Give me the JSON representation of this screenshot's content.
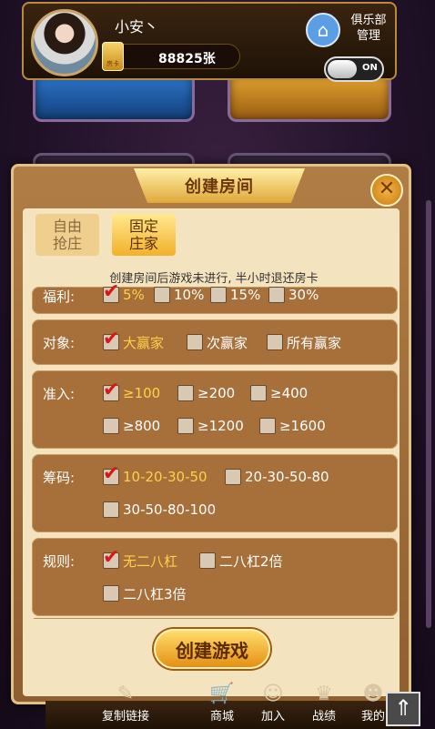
{
  "user": {
    "nickname": "小安丶",
    "card_count": "88825张",
    "card_icon_text": "房卡",
    "club_label": "俱乐部管理",
    "toggle_label": "ON",
    "toggle_on": true
  },
  "dialog": {
    "title": "创建房间",
    "close_icon": "close-icon",
    "mode_tabs": [
      {
        "label": "自由抢庄",
        "selected": false
      },
      {
        "label": "固定庄家",
        "selected": true
      }
    ],
    "notice": "创建房间后游戏未进行, 半小时退还房卡",
    "sections": {
      "welfare": {
        "label": "福利:",
        "options": [
          {
            "text": "5%",
            "checked": true
          },
          {
            "text": "10%",
            "checked": false
          },
          {
            "text": "15%",
            "checked": false
          },
          {
            "text": "30%",
            "checked": false
          }
        ]
      },
      "target": {
        "label": "对象:",
        "options": [
          {
            "text": "大赢家",
            "checked": true
          },
          {
            "text": "次赢家",
            "checked": false
          },
          {
            "text": "所有赢家",
            "checked": false
          }
        ]
      },
      "entry": {
        "label": "准入:",
        "options": [
          {
            "text": "≥100",
            "checked": true
          },
          {
            "text": "≥200",
            "checked": false
          },
          {
            "text": "≥400",
            "checked": false
          },
          {
            "text": "≥800",
            "checked": false
          },
          {
            "text": "≥1200",
            "checked": false
          },
          {
            "text": "≥1600",
            "checked": false
          }
        ]
      },
      "chips": {
        "label": "筹码:",
        "options": [
          {
            "text": "10-20-30-50",
            "checked": true
          },
          {
            "text": "20-30-50-80",
            "checked": false
          },
          {
            "text": "30-50-80-100",
            "checked": false
          }
        ]
      },
      "rules": {
        "label": "规则:",
        "options": [
          {
            "text": "无二八杠",
            "checked": true
          },
          {
            "text": "二八杠2倍",
            "checked": false
          },
          {
            "text": "二八杠3倍",
            "checked": false
          }
        ]
      }
    },
    "create_button": "创建游戏"
  },
  "bottom_nav": {
    "items": [
      {
        "label": "复制链接",
        "icon": "copy-link-icon"
      },
      {
        "label": "商城",
        "icon": "shop-cart-icon"
      },
      {
        "label": "加入",
        "icon": "join-user-icon"
      },
      {
        "label": "战绩",
        "icon": "trophy-icon"
      },
      {
        "label": "我的",
        "icon": "profile-icon"
      }
    ],
    "scroll_top_icon": "arrow-up-icon"
  },
  "colors": {
    "selected_text": "#ffd04a",
    "check_mark": "#d41818",
    "panel": "#a76f3a"
  }
}
